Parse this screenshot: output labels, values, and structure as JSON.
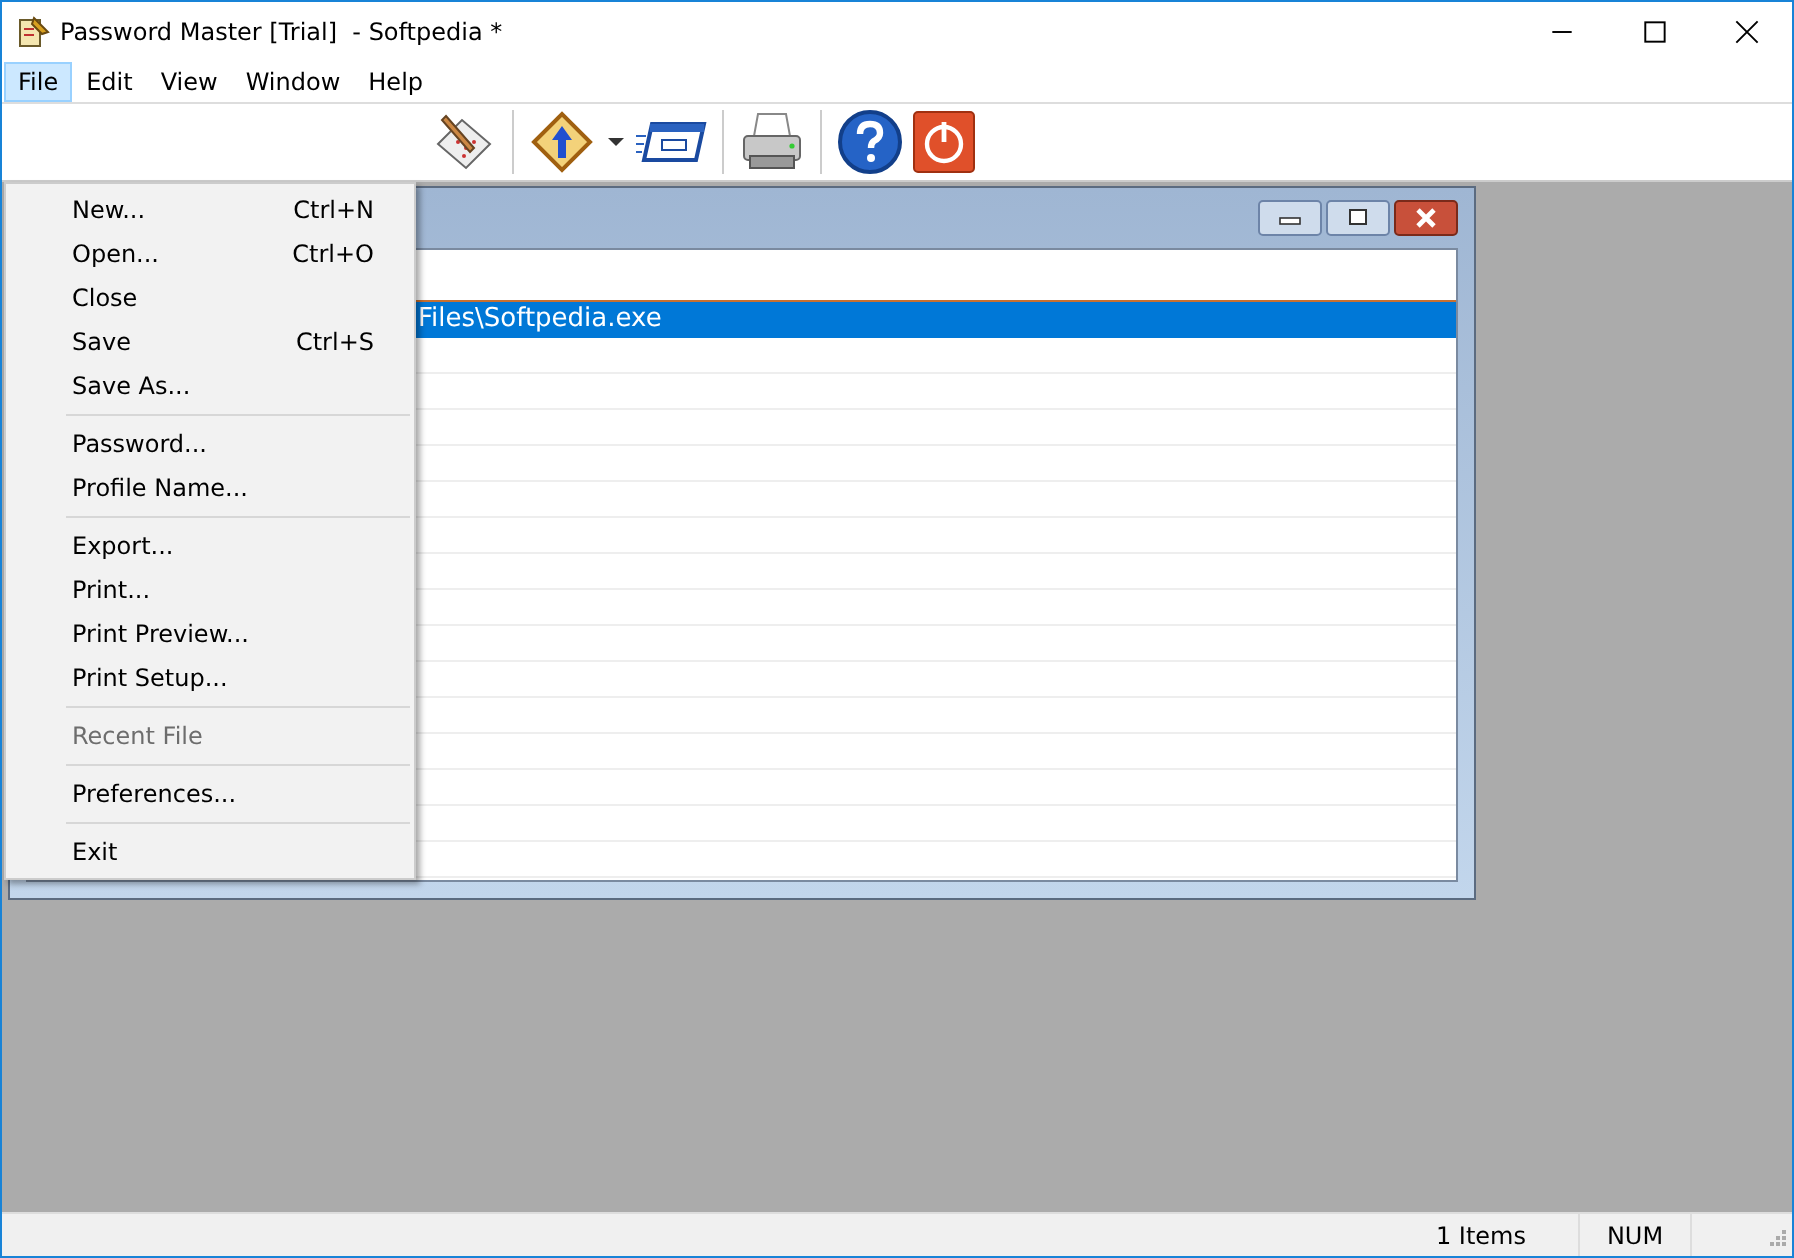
{
  "window": {
    "title": "Password Master [Trial]  - Softpedia *"
  },
  "menu_bar": [
    {
      "label": "File",
      "selected": true
    },
    {
      "label": "Edit",
      "selected": false
    },
    {
      "label": "View",
      "selected": false
    },
    {
      "label": "Window",
      "selected": false
    },
    {
      "label": "Help",
      "selected": false
    }
  ],
  "file_menu": [
    {
      "kind": "item",
      "label": "New...",
      "shortcut": "Ctrl+N",
      "disabled": false
    },
    {
      "kind": "item",
      "label": "Open...",
      "shortcut": "Ctrl+O",
      "disabled": false
    },
    {
      "kind": "item",
      "label": "Close",
      "disabled": false
    },
    {
      "kind": "item",
      "label": "Save",
      "shortcut": "Ctrl+S",
      "disabled": false
    },
    {
      "kind": "item",
      "label": "Save As...",
      "disabled": false
    },
    {
      "kind": "separator"
    },
    {
      "kind": "item",
      "label": "Password...",
      "disabled": false
    },
    {
      "kind": "item",
      "label": "Profile Name...",
      "disabled": false
    },
    {
      "kind": "separator"
    },
    {
      "kind": "item",
      "label": "Export...",
      "disabled": false
    },
    {
      "kind": "item",
      "label": "Print...",
      "disabled": false
    },
    {
      "kind": "item",
      "label": "Print Preview...",
      "disabled": false
    },
    {
      "kind": "item",
      "label": "Print Setup...",
      "disabled": false
    },
    {
      "kind": "separator"
    },
    {
      "kind": "item",
      "label": "Recent File",
      "disabled": true
    },
    {
      "kind": "separator"
    },
    {
      "kind": "item",
      "label": "Preferences...",
      "disabled": false
    },
    {
      "kind": "separator"
    },
    {
      "kind": "item",
      "label": "Exit",
      "disabled": false
    }
  ],
  "child_window": {
    "rows": [
      {
        "path": "Files\\Softpedia.exe",
        "selected": true
      }
    ]
  },
  "status_bar": {
    "count": "1 Items",
    "num_lock": "NUM"
  }
}
